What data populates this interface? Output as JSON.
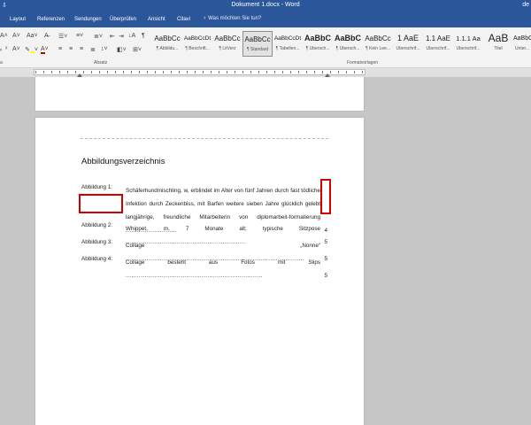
{
  "window": {
    "title": "Dokument 1.docx - Word",
    "user": "de"
  },
  "quick_access": "⇩",
  "tabs": [
    "Layout",
    "Referenzen",
    "Sendungen",
    "Überprüfen",
    "Ansicht",
    "Citavi"
  ],
  "tell_me": "Was möchten Sie tun?",
  "ribbon": {
    "groups": {
      "absatz": "Absatz",
      "formatvorlagen": "Formatvorlagen",
      "left": "a"
    },
    "styles": [
      {
        "sample": "AaBbCc",
        "name": "¶ Abbildu..."
      },
      {
        "sample": "AaBbCcDt",
        "name": "¶ Beschrift..."
      },
      {
        "sample": "AaBbCc",
        "name": "¶ LitVerz"
      },
      {
        "sample": "AaBbCc",
        "name": "¶ Standard"
      },
      {
        "sample": "AaBbCcDt",
        "name": "¶ Tabellen..."
      },
      {
        "sample": "AaBbC",
        "name": "¶ Übersch..."
      },
      {
        "sample": "AaBbC",
        "name": "¶ Übersch..."
      },
      {
        "sample": "AaBbCc",
        "name": "¶ Kein Lee..."
      },
      {
        "sample": "1 AaE",
        "name": "Überschrif..."
      },
      {
        "sample": "1.1 AaE",
        "name": "Überschrif..."
      },
      {
        "sample": "1.1.1 Aa",
        "name": "Überschrif..."
      },
      {
        "sample": "AaB",
        "name": "Titel"
      },
      {
        "sample": "AaBbCcDt",
        "name": "Unter..."
      }
    ]
  },
  "document": {
    "title": "Abbildungsverzeichnis",
    "header_mark": "",
    "entries": [
      {
        "label": "Abbildung 1:",
        "text": "Schäferhundmischling, w, erblindet im Alter von fünf Jahren durch fast tödliche Infektion durch Zeckenbiss, mit Barfen weitere sieben Jahre glücklich gelebt langjährige, freundliche Mitarbeiterin von diplomarbeit-formatierung",
        "page": "4"
      },
      {
        "label": "Abbildung 2:",
        "text": "Whippet, m, 7 Monate alt; typische Sitzpose",
        "page": "5"
      },
      {
        "label": "Abbildung 3:",
        "text": "Collage „Nonne“",
        "page": "5"
      },
      {
        "label": "Abbildung 4:",
        "text": "Collage besteht aus Fotos mit Slips",
        "page": "5"
      }
    ]
  },
  "colors": {
    "accent": "#2b579a",
    "highlight_box": "#d10000"
  }
}
